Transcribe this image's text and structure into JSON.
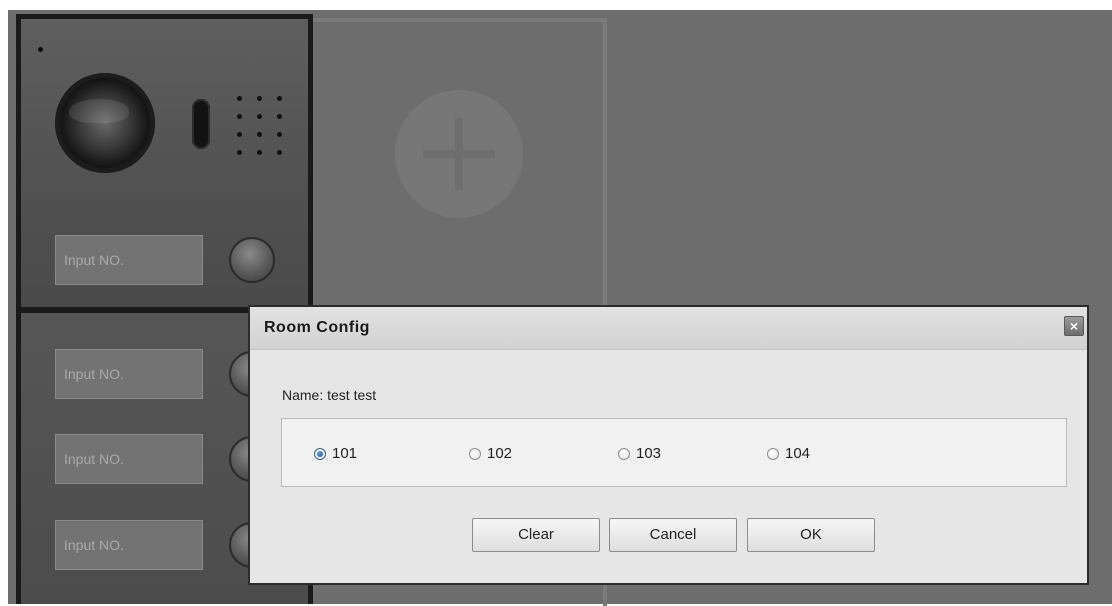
{
  "door_station": {
    "top_input_placeholder": "Input NO.",
    "bottom_inputs": [
      {
        "placeholder": "Input NO."
      },
      {
        "placeholder": "Input NO."
      },
      {
        "placeholder": "Input NO."
      }
    ]
  },
  "add_module": {
    "icon": "plus-icon"
  },
  "dialog": {
    "title": "Room Config",
    "close_icon": "close-icon",
    "name_label": "Name: test test",
    "rooms": [
      {
        "label": "101",
        "checked": true
      },
      {
        "label": "102",
        "checked": false
      },
      {
        "label": "103",
        "checked": false
      },
      {
        "label": "104",
        "checked": false
      }
    ],
    "buttons": {
      "clear": "Clear",
      "cancel": "Cancel",
      "ok": "OK"
    }
  },
  "colors": {
    "background": "#6d6d6d",
    "dialog_bg": "#e6e6e6",
    "radio_selected": "#1d4c82"
  }
}
